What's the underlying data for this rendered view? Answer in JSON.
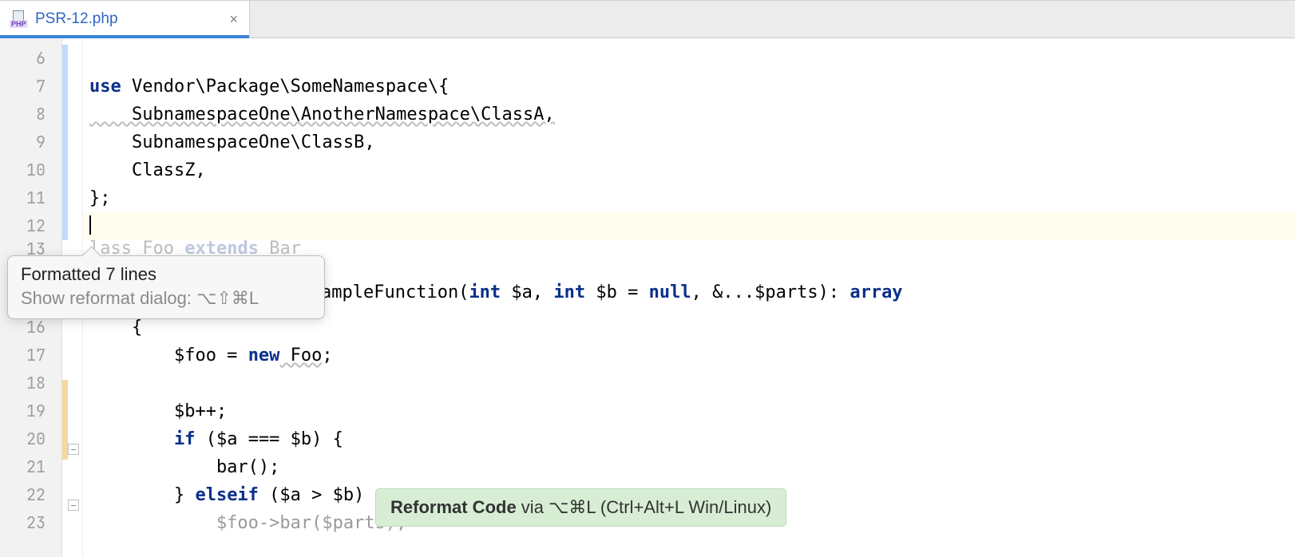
{
  "tab": {
    "filename": "PSR-12.php",
    "badge": "PHP"
  },
  "gutter": {
    "lines": [
      "6",
      "7",
      "8",
      "9",
      "10",
      "11",
      "12",
      "13",
      "",
      "16",
      "17",
      "18",
      "19",
      "20",
      "21",
      "22",
      "23"
    ]
  },
  "code": {
    "l6": "",
    "l7a": "use",
    "l7b": " Vendor\\Package\\SomeNamespace\\{",
    "l8": "    SubnamespaceOne\\AnotherNamespace\\ClassA,",
    "l9": "    SubnamespaceOne\\ClassB,",
    "l10": "    ClassZ,",
    "l11": "};",
    "l12": "",
    "l13a": "lass ",
    "l13b": "Foo",
    "l13c": " extends",
    "l13d": " Bar",
    "l15a": "ampleFunction(",
    "l15b": "int",
    "l15c": " $a, ",
    "l15d": "int",
    "l15e": " $b = ",
    "l15f": "null",
    "l15g": ", &...$parts): ",
    "l15h": "array",
    "l16": "    {",
    "l17a": "        $foo = ",
    "l17b": "new",
    "l17c": " Foo",
    "l17d": ";",
    "l18": "",
    "l19": "        $b++;",
    "l20a": "        ",
    "l20b": "if",
    "l20c": " ($a === $b) {",
    "l21": "            bar();",
    "l22a": "        } ",
    "l22b": "elseif",
    "l22c": " ($a > $b)",
    "l23": "            $foo->bar($parts);"
  },
  "popup": {
    "line1": "Formatted 7 lines",
    "line2": "Show reformat dialog: ⌥⇧⌘L"
  },
  "hint": {
    "bold": "Reformat Code",
    "rest": " via ⌥⌘L (Ctrl+Alt+L Win/Linux)"
  }
}
